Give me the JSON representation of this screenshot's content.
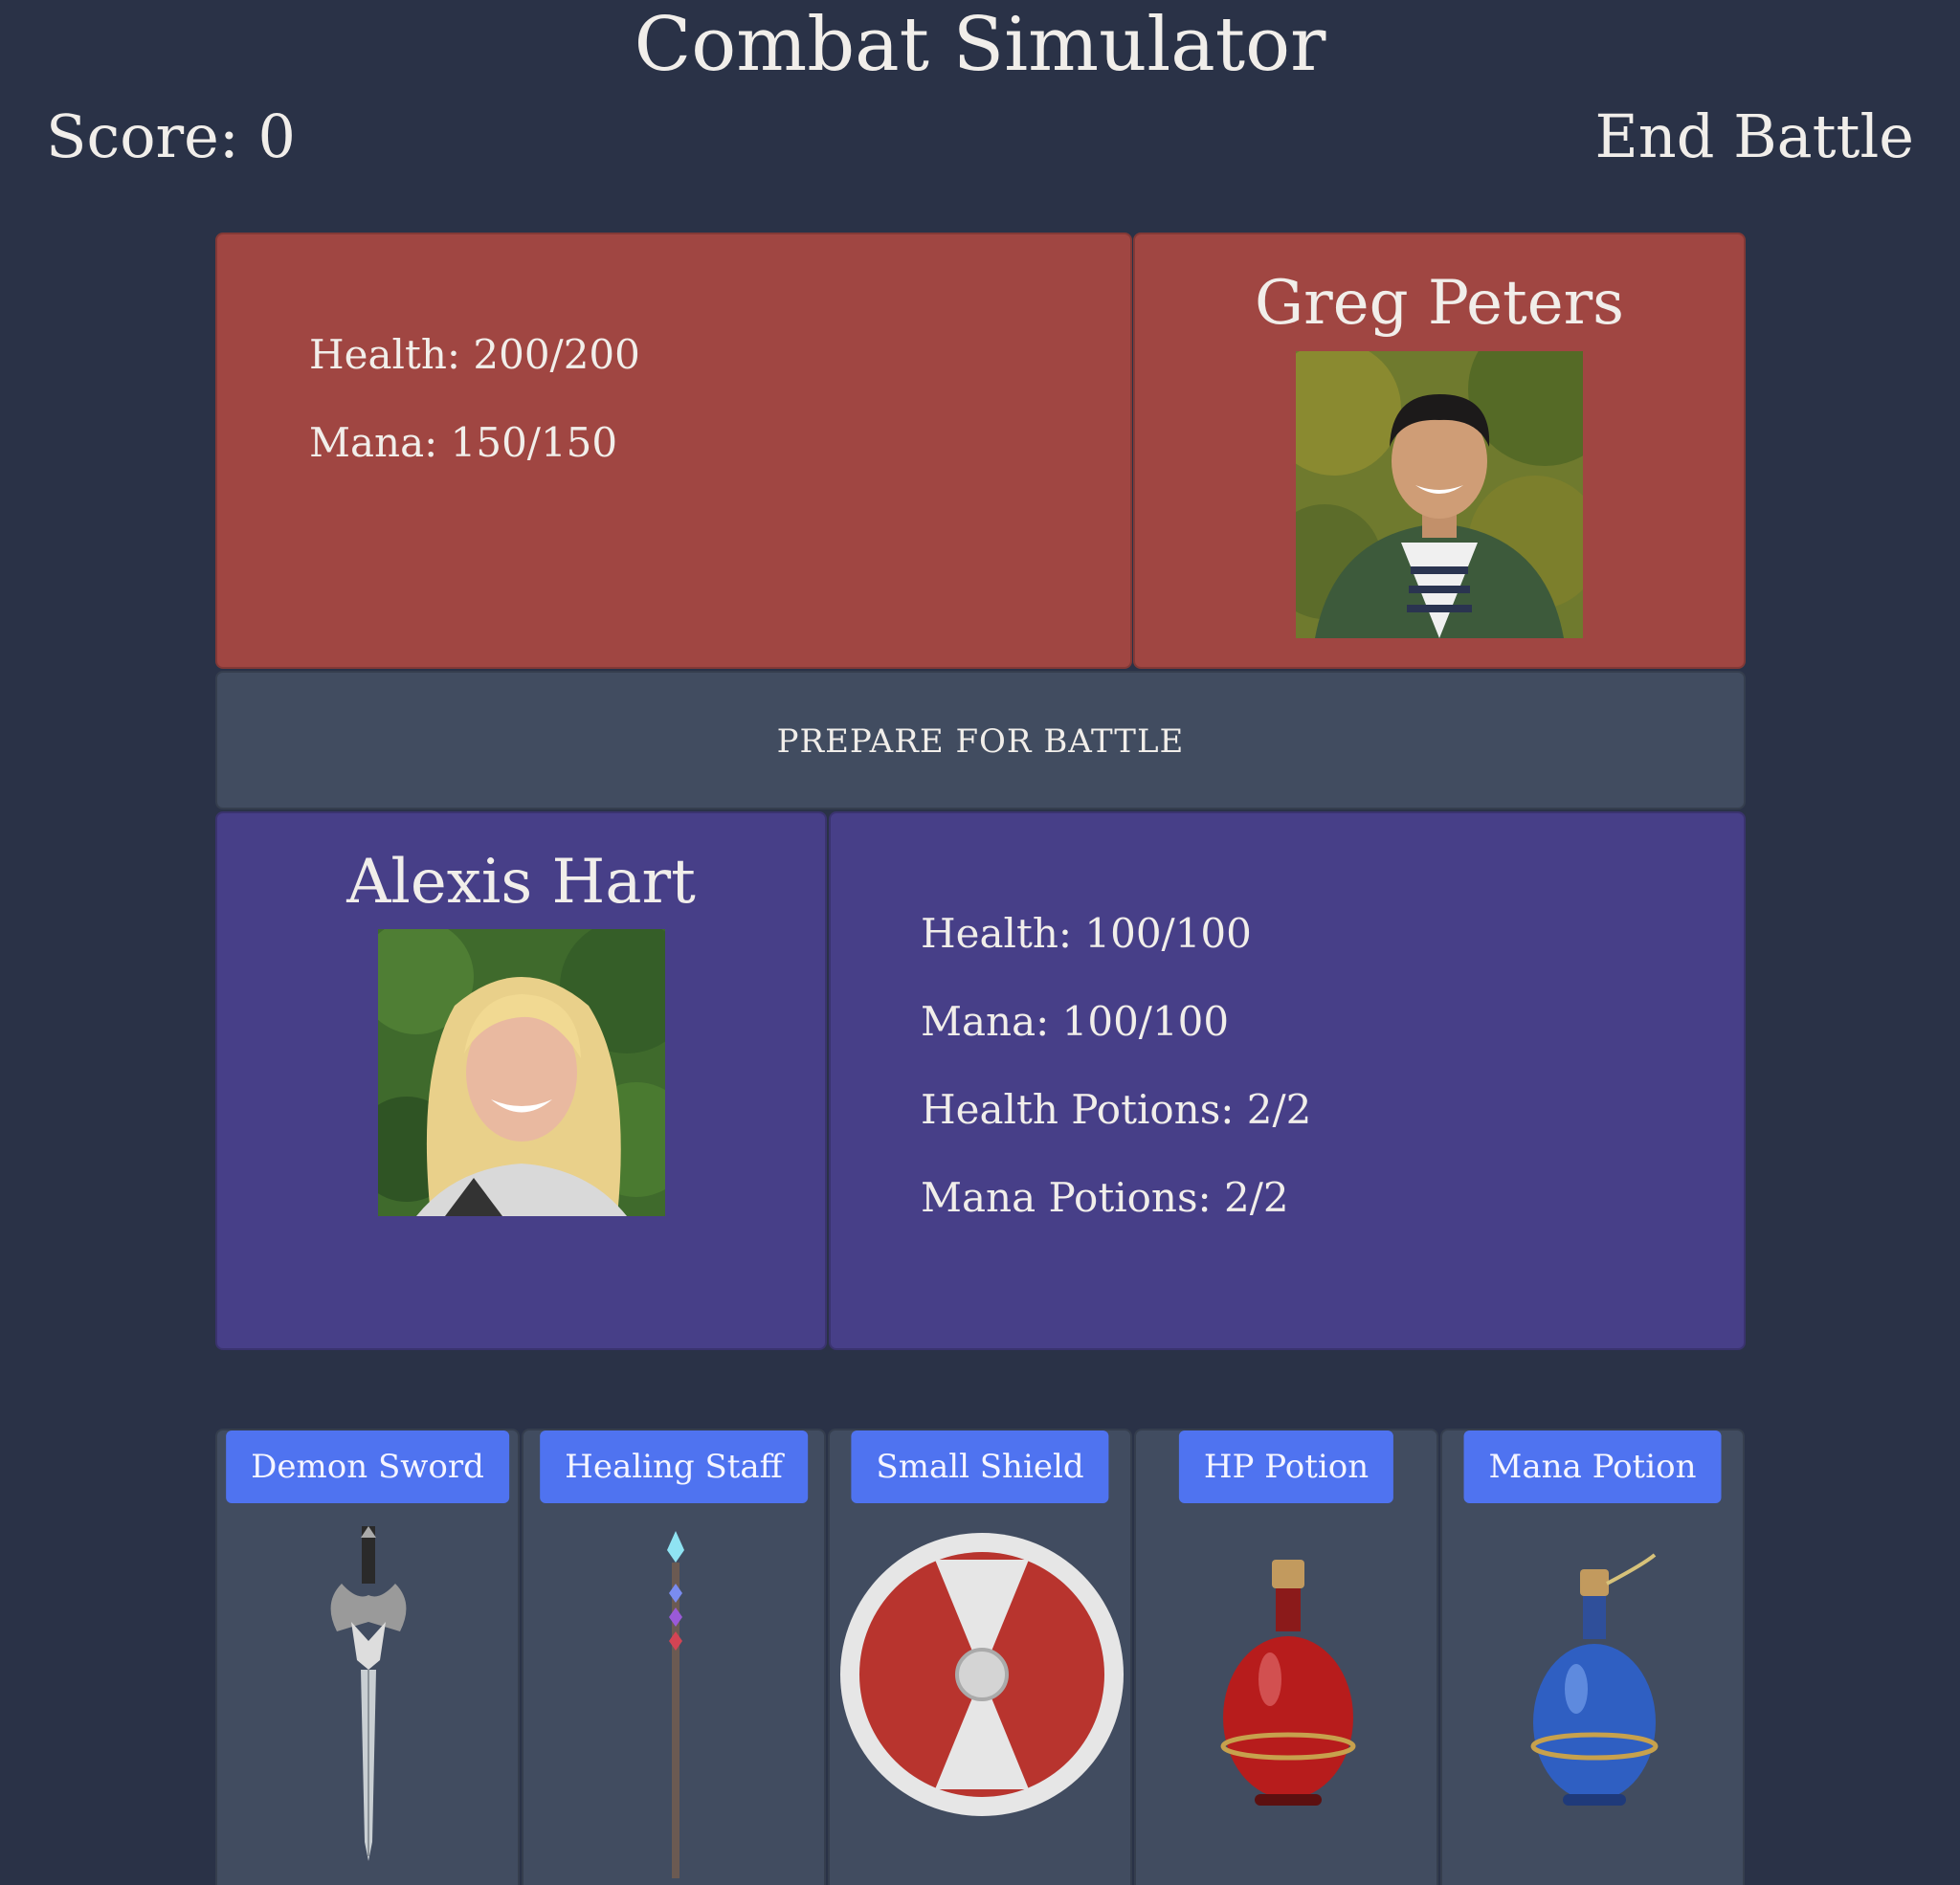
{
  "header": {
    "title": "Combat Simulator",
    "score_label": "Score: 0",
    "end_battle_label": "End Battle"
  },
  "enemy": {
    "name": "Greg Peters",
    "health": "Health: 200/200",
    "mana": "Mana: 150/150",
    "panel_color": "#a04642"
  },
  "status": {
    "message": "PREPARE FOR BATTLE"
  },
  "player": {
    "name": "Alexis Hart",
    "health": "Health: 100/100",
    "mana": "Mana: 100/100",
    "health_potions": "Health Potions: 2/2",
    "mana_potions": "Mana Potions: 2/2",
    "panel_color": "#473f88"
  },
  "items": [
    {
      "label": "Demon Sword",
      "icon": "sword-icon"
    },
    {
      "label": "Healing Staff",
      "icon": "staff-icon"
    },
    {
      "label": "Small Shield",
      "icon": "shield-icon"
    },
    {
      "label": "HP Potion",
      "icon": "hp-potion-icon"
    },
    {
      "label": "Mana Potion",
      "icon": "mana-potion-icon"
    }
  ],
  "colors": {
    "background": "#2a3247",
    "neutral_panel": "#414c60",
    "button": "#4f73f0"
  }
}
